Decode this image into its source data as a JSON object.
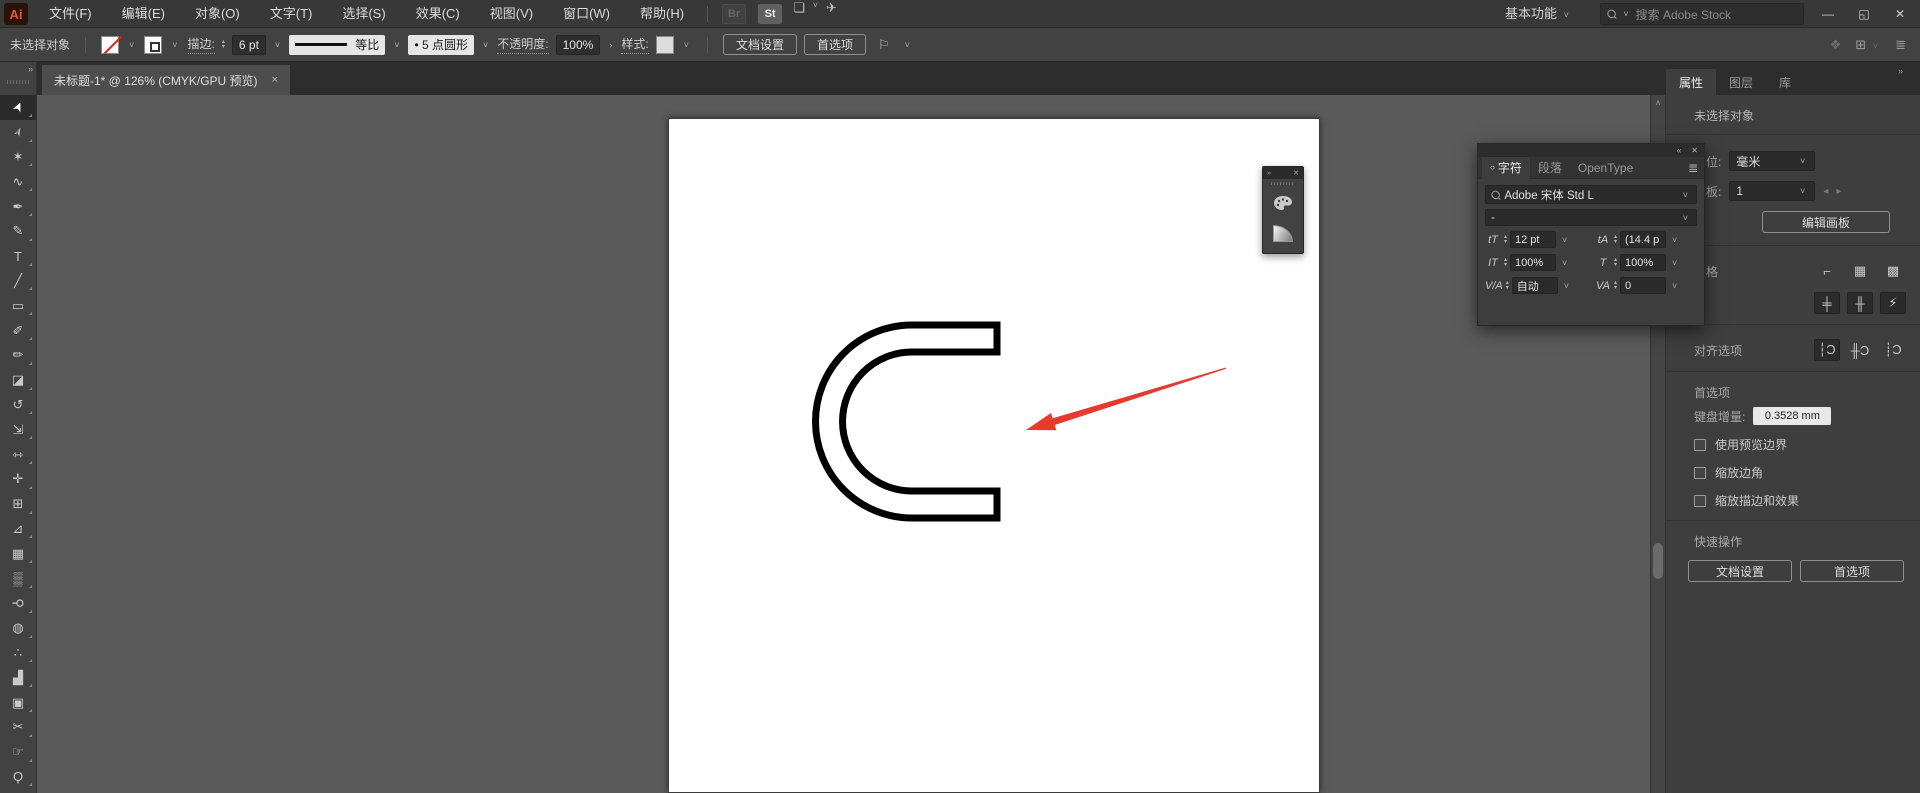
{
  "titlebar": {
    "logo": "Ai",
    "menus": [
      "文件(F)",
      "编辑(E)",
      "对象(O)",
      "文字(T)",
      "选择(S)",
      "效果(C)",
      "视图(V)",
      "窗口(W)",
      "帮助(H)"
    ],
    "bridge_badge": "Br",
    "stock_badge": "St",
    "workspace": "基本功能",
    "search_placeholder": "搜索 Adobe Stock",
    "window": {
      "minimize": "—",
      "restore": "◱",
      "close": "✕"
    }
  },
  "controlbar": {
    "no_selection": "未选择对象",
    "stroke_label": "描边:",
    "stroke_value": "6 pt",
    "profile_value": "等比",
    "brush_value": "•  5 点圆形",
    "opacity_label": "不透明度:",
    "opacity_value": "100%",
    "more_arrow": "›",
    "style_label": "样式:",
    "doc_setup": "文档设置",
    "preferences": "首选项",
    "right_icons": [
      "❖",
      "⊞",
      "≣"
    ]
  },
  "document_tab": {
    "title": "未标题-1* @ 126% (CMYK/GPU 预览)",
    "close": "×"
  },
  "toolbar": {
    "tools": [
      {
        "n": "selection-tool",
        "g": "➤"
      },
      {
        "n": "direct-selection-tool",
        "g": "➢"
      },
      {
        "n": "magic-wand-tool",
        "g": "✶"
      },
      {
        "n": "lasso-tool",
        "g": "∿"
      },
      {
        "n": "pen-tool",
        "g": "✒"
      },
      {
        "n": "curvature-tool",
        "g": "✎"
      },
      {
        "n": "type-tool",
        "g": "T"
      },
      {
        "n": "line-segment-tool",
        "g": "╱"
      },
      {
        "n": "rectangle-tool",
        "g": "▭"
      },
      {
        "n": "paintbrush-tool",
        "g": "✐"
      },
      {
        "n": "shaper-tool",
        "g": "✏"
      },
      {
        "n": "eraser-tool",
        "g": "◪"
      },
      {
        "n": "rotate-tool",
        "g": "↺"
      },
      {
        "n": "scale-tool",
        "g": "⇲"
      },
      {
        "n": "width-tool",
        "g": "⇿"
      },
      {
        "n": "puppet-warp-tool",
        "g": "✛"
      },
      {
        "n": "shape-builder-tool",
        "g": "⊞"
      },
      {
        "n": "perspective-grid-tool",
        "g": "⊿"
      },
      {
        "n": "mesh-tool",
        "g": "▦"
      },
      {
        "n": "gradient-tool",
        "g": "▒"
      },
      {
        "n": "eyedropper-tool",
        "g": "⚲"
      },
      {
        "n": "blend-tool",
        "g": "◍"
      },
      {
        "n": "symbol-sprayer-tool",
        "g": "∴"
      },
      {
        "n": "column-graph-tool",
        "g": "▟"
      },
      {
        "n": "artboard-tool",
        "g": "▣"
      },
      {
        "n": "slice-tool",
        "g": "✂"
      },
      {
        "n": "hand-tool",
        "g": "☞"
      },
      {
        "n": "zoom-tool",
        "g": "Ϙ"
      }
    ]
  },
  "canvas": {
    "artwork": "outlined letter C",
    "stroke_color": "#000000",
    "arrow_color": "#e8392f"
  },
  "mini_panel": {
    "collapse": "»",
    "close": "✕",
    "icons": [
      "color-panel",
      "gradient-panel"
    ]
  },
  "character_panel": {
    "collapse": "«",
    "close": "✕",
    "tabs": [
      "字符",
      "段落",
      "OpenType"
    ],
    "menu_icon": "≣",
    "font_name": "Adobe 宋体 Std L",
    "font_style": "-",
    "size": {
      "icon": "tT",
      "value": "12 pt"
    },
    "leading": {
      "icon": "tA",
      "value": "(14.4 p"
    },
    "vscale": {
      "icon": "IT",
      "value": "100%"
    },
    "hscale": {
      "icon": "T",
      "value": "100%"
    },
    "kerning": {
      "icon": "V/A",
      "value": "自动"
    },
    "tracking": {
      "icon": "VA",
      "value": "0"
    }
  },
  "dock": {
    "expand": "»",
    "tabs": [
      "属性",
      "图层",
      "库"
    ],
    "no_selection": "未选择对象",
    "unit_label": "单位:",
    "unit_value": "毫米",
    "artboard_label": "画板:",
    "artboard_value": "1",
    "prev": "◂",
    "next": "▸",
    "edit_artboard": "编辑画板",
    "grid_label": "网格",
    "grid_icons": [
      "⌐",
      "▦",
      "▩"
    ],
    "snap_icons": [
      "╪",
      "╫",
      "⚡"
    ],
    "align_label": "对齐选项",
    "align_icons": [
      "┆Ɔ",
      "╫Ɔ",
      "┊Ɔ"
    ],
    "prefs_label": "首选项",
    "keyboard_label": "键盘增量:",
    "keyboard_value": "0.3528 mm",
    "checkboxes": [
      "使用预览边界",
      "缩放边角",
      "缩放描边和效果"
    ],
    "quick_label": "快速操作",
    "quick_buttons": [
      "文档设置",
      "首选项"
    ]
  }
}
